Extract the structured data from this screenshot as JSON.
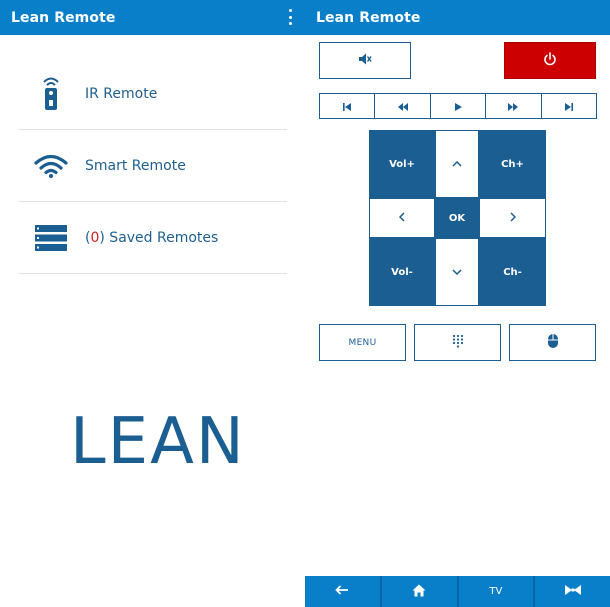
{
  "left": {
    "title": "Lean Remote",
    "menu": [
      {
        "label": "IR Remote",
        "icon": "ir-remote-icon"
      },
      {
        "label": "Smart Remote",
        "icon": "wifi-icon"
      },
      {
        "count_open": "(",
        "count": "0",
        "count_close": ")",
        "label": " Saved Remotes",
        "icon": "list-icon"
      }
    ],
    "logo": "LEAN"
  },
  "right": {
    "title": "Lean Remote",
    "pad": {
      "vol_up": "Vol+",
      "ch_up": "Ch+",
      "ok": "OK",
      "vol_down": "Vol-",
      "ch_down": "Ch-"
    },
    "bottom": {
      "menu_label": "MENU"
    },
    "navbar": {
      "tv_label": "TV"
    }
  },
  "colors": {
    "appbar": "#0a7fc9",
    "primary": "#1b5e92",
    "power": "#cc0000",
    "count": "#d32020"
  }
}
